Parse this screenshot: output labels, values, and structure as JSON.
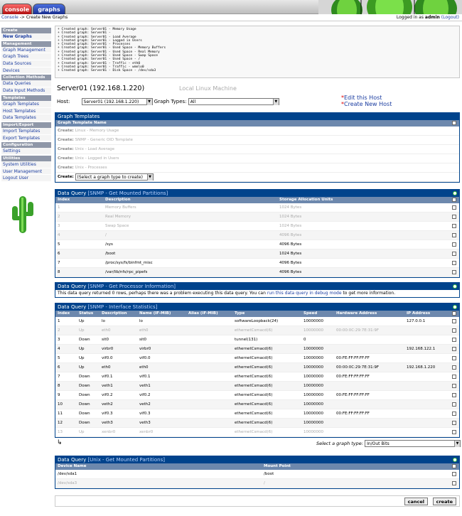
{
  "tabs": {
    "console": "console",
    "graphs": "graphs"
  },
  "breadcrumb": {
    "root": "Console",
    "sep": " -> ",
    "current": "Create New Graphs"
  },
  "login": {
    "prefix": "Logged in as ",
    "user": "admin",
    "logout": "(Logout)"
  },
  "sidebar": [
    {
      "type": "h",
      "label": "Create"
    },
    {
      "type": "i",
      "label": "New Graphs",
      "bold": true
    },
    {
      "type": "h",
      "label": "Management"
    },
    {
      "type": "i",
      "label": "Graph Management"
    },
    {
      "type": "i",
      "label": "Graph Trees"
    },
    {
      "type": "i",
      "label": "Data Sources"
    },
    {
      "type": "i",
      "label": "Devices"
    },
    {
      "type": "h",
      "label": "Collection Methods"
    },
    {
      "type": "i",
      "label": "Data Queries"
    },
    {
      "type": "i",
      "label": "Data Input Methods"
    },
    {
      "type": "h",
      "label": "Templates"
    },
    {
      "type": "i",
      "label": "Graph Templates"
    },
    {
      "type": "i",
      "label": "Host Templates"
    },
    {
      "type": "i",
      "label": "Data Templates"
    },
    {
      "type": "h",
      "label": "Import/Export"
    },
    {
      "type": "i",
      "label": "Import Templates"
    },
    {
      "type": "i",
      "label": "Export Templates"
    },
    {
      "type": "h",
      "label": "Configuration"
    },
    {
      "type": "i",
      "label": "Settings"
    },
    {
      "type": "h",
      "label": "Utilities"
    },
    {
      "type": "i",
      "label": "System Utilities"
    },
    {
      "type": "i",
      "label": "User Management"
    },
    {
      "type": "i",
      "label": "Logout User"
    }
  ],
  "log": [
    "+ Created graph: Server01 - Memory Usage",
    "+ Created graph: Server01 - ",
    "+ Created graph: Server01 - Load Average",
    "+ Created graph: Server01 - Logged in Users",
    "+ Created graph: Server01 - Processes",
    "+ Created graph: Server01 - Used Space - Memory Buffers",
    "+ Created graph: Server01 - Used Space - Real Memory",
    "+ Created graph: Server01 - Used Space - Swap Space",
    "+ Created graph: Server01 - Used Space - /",
    "+ Created graph: Server01 - Traffic - eth0",
    "+ Created graph: Server01 - Traffic - wmnlo0",
    "+ Created graph: Server01 - Disk Space - /dev/sda3"
  ],
  "host": {
    "title": "Server01 (192.168.1.220)",
    "description": "Local Linux Machine",
    "label": "Host:",
    "selected": "Server01 (192.168.1.220)",
    "graph_types_label": "Graph Types:",
    "graph_types_value": "All",
    "edit_link": "Edit this Host",
    "create_link": "Create New Host"
  },
  "graph_templates": {
    "title": "Graph Templates",
    "col": "Graph Template Name",
    "prefix": "Create: ",
    "items": [
      "Linux - Memory Usage",
      "SNMP - Generic OID Template",
      "Unix - Load Average",
      "Unix - Logged in Users",
      "Unix - Processes"
    ],
    "select_label": "Create:",
    "select_value": "(Select a graph type to create)"
  },
  "dq_mount": {
    "title": "Data Query",
    "sub": "[SNMP - Get Mounted Partitions]",
    "cols": [
      "Index",
      "Description",
      "Storage Allocation Units"
    ],
    "rows": [
      {
        "c": [
          "1",
          "Memory Buffers",
          "1024 Bytes"
        ],
        "dim": true
      },
      {
        "c": [
          "2",
          "Real Memory",
          "1024 Bytes"
        ],
        "dim": true
      },
      {
        "c": [
          "3",
          "Swap Space",
          "1024 Bytes"
        ],
        "dim": true
      },
      {
        "c": [
          "4",
          "/",
          "4096 Bytes"
        ],
        "dim": true
      },
      {
        "c": [
          "5",
          "/sys",
          "4096 Bytes"
        ],
        "dim": false
      },
      {
        "c": [
          "6",
          "/boot",
          "1024 Bytes"
        ],
        "dim": false
      },
      {
        "c": [
          "7",
          "/proc/sys/fs/binfmt_misc",
          "4096 Bytes"
        ],
        "dim": false
      },
      {
        "c": [
          "8",
          "/var/lib/nfs/rpc_pipefs",
          "4096 Bytes"
        ],
        "dim": false
      }
    ]
  },
  "dq_proc": {
    "title": "Data Query",
    "sub": "[SNMP - Get Processor Information]",
    "msg_a": "This data query returned 0 rows, perhaps there was a problem executing this data query. You can ",
    "link": "run this data query in debug mode",
    "msg_b": " to get more information."
  },
  "dq_if": {
    "title": "Data Query",
    "sub": "[SNMP - Interface Statistics]",
    "cols": [
      "Index",
      "Status",
      "Description",
      "Name (IF-MIB)",
      "Alias (IF-MIB)",
      "Type",
      "Speed",
      "Hardware Address",
      "IP Address"
    ],
    "rows": [
      {
        "c": [
          "1",
          "Up",
          "lo",
          "lo",
          "",
          "softwareLoopback(24)",
          "10000000",
          "",
          "127.0.0.1"
        ],
        "dim": false
      },
      {
        "c": [
          "2",
          "Up",
          "eth0",
          "eth0",
          "",
          "ethernetCsmacd(6)",
          "10000000",
          "00:00:0C:29:7E:31:9F",
          ""
        ],
        "dim": true
      },
      {
        "c": [
          "3",
          "Down",
          "sit0",
          "sit0",
          "",
          "tunnel(131)",
          "0",
          "",
          ""
        ],
        "dim": false
      },
      {
        "c": [
          "4",
          "Up",
          "virbr0",
          "virbr0",
          "",
          "ethernetCsmacd(6)",
          "10000000",
          "",
          "192.168.122.1"
        ],
        "dim": false
      },
      {
        "c": [
          "5",
          "Up",
          "vif0.0",
          "vif0.0",
          "",
          "ethernetCsmacd(6)",
          "10000000",
          "00:FE:FF:FF:FF:FF",
          ""
        ],
        "dim": false
      },
      {
        "c": [
          "6",
          "Up",
          "eth0",
          "eth0",
          "",
          "ethernetCsmacd(6)",
          "10000000",
          "00:00:0C:29:7E:31:9F",
          "192.168.1.220"
        ],
        "dim": false
      },
      {
        "c": [
          "7",
          "Down",
          "vif0.1",
          "vif0.1",
          "",
          "ethernetCsmacd(6)",
          "10000000",
          "00:FE:FF:FF:FF:FF",
          ""
        ],
        "dim": false
      },
      {
        "c": [
          "8",
          "Down",
          "veth1",
          "veth1",
          "",
          "ethernetCsmacd(6)",
          "10000000",
          "",
          ""
        ],
        "dim": false
      },
      {
        "c": [
          "9",
          "Down",
          "vif0.2",
          "vif0.2",
          "",
          "ethernetCsmacd(6)",
          "10000000",
          "00:FE:FF:FF:FF:FF",
          ""
        ],
        "dim": false
      },
      {
        "c": [
          "10",
          "Down",
          "veth2",
          "veth2",
          "",
          "ethernetCsmacd(6)",
          "10000000",
          "",
          ""
        ],
        "dim": false
      },
      {
        "c": [
          "11",
          "Down",
          "vif0.3",
          "vif0.3",
          "",
          "ethernetCsmacd(6)",
          "10000000",
          "00:FE:FF:FF:FF:FF",
          ""
        ],
        "dim": false
      },
      {
        "c": [
          "12",
          "Down",
          "veth3",
          "veth3",
          "",
          "ethernetCsmacd(6)",
          "10000000",
          "",
          ""
        ],
        "dim": false
      },
      {
        "c": [
          "13",
          "Up",
          "xenbr0",
          "xenbr0",
          "",
          "ethernetCsmacd(6)",
          "10000000",
          "",
          ""
        ],
        "dim": true
      }
    ],
    "select_label": "Select a graph type:",
    "select_value": "In/Out Bits"
  },
  "dq_unix": {
    "title": "Data Query",
    "sub": "[Unix - Get Mounted Partitions]",
    "cols": [
      "Device Name",
      "Mount Point"
    ],
    "rows": [
      {
        "c": [
          "/dev/sda1",
          "/boot"
        ],
        "dim": false
      },
      {
        "c": [
          "/dev/sda3",
          "/"
        ],
        "dim": true
      }
    ]
  },
  "buttons": {
    "cancel": "cancel",
    "create": "create"
  }
}
